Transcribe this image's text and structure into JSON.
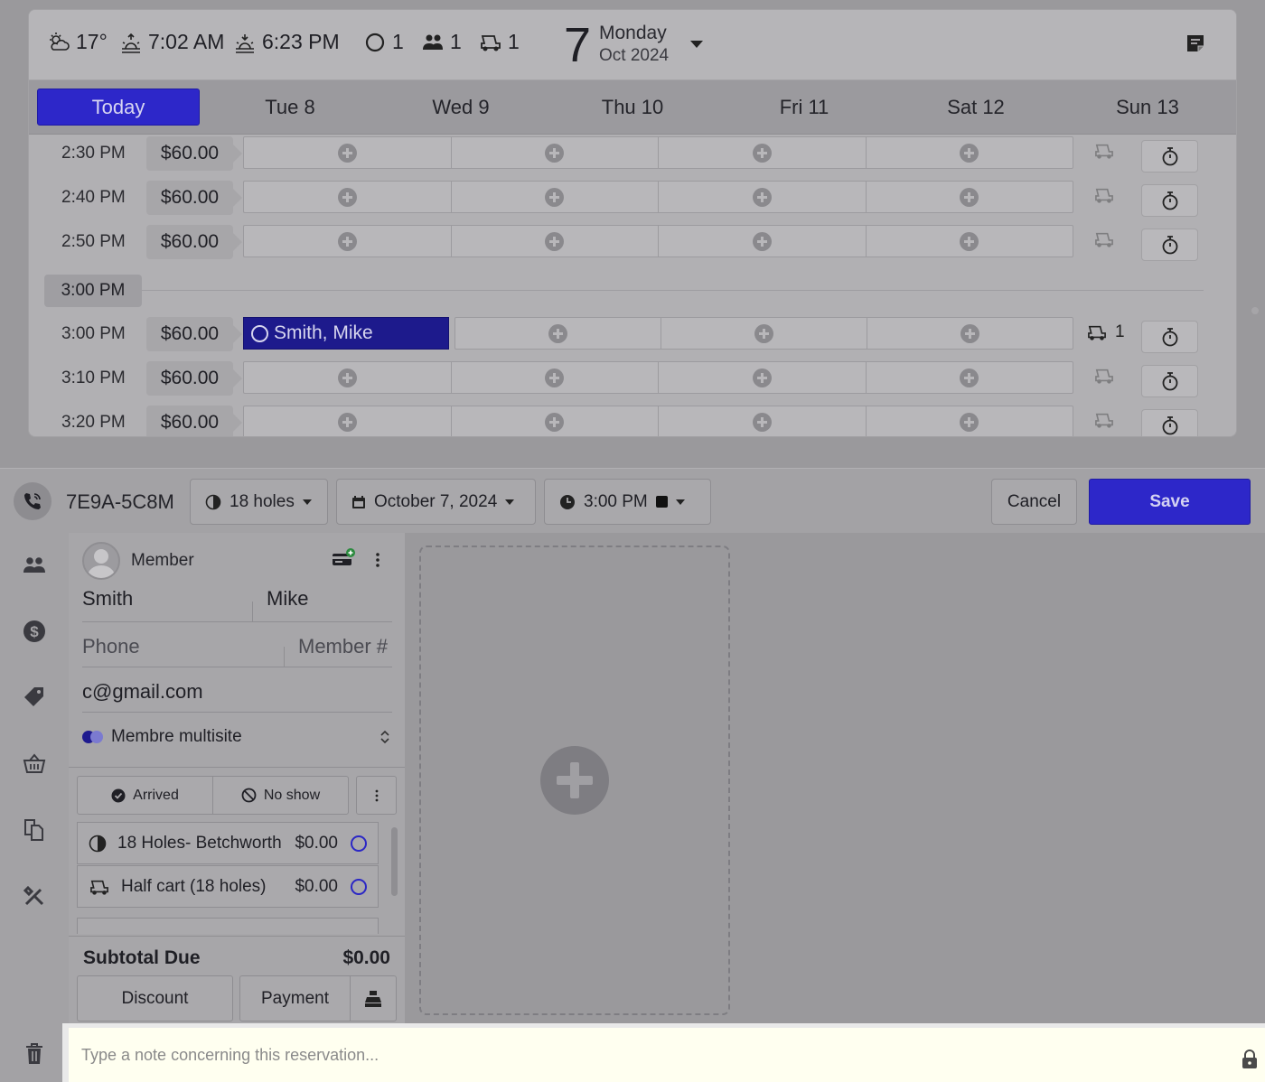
{
  "weather": {
    "temperature": "17°",
    "sunrise": "7:02 AM",
    "sunset": "6:23 PM"
  },
  "counters": {
    "reservations": "1",
    "players": "1",
    "carts": "1"
  },
  "current_date": {
    "day_number": "7",
    "day_name": "Monday",
    "month_year": "Oct 2024"
  },
  "day_tabs": [
    "Today",
    "Tue 8",
    "Wed 9",
    "Thu 10",
    "Fri 11",
    "Sat 12",
    "Sun 13"
  ],
  "tee_times": [
    {
      "time": "2:30 PM",
      "price": "$60.00"
    },
    {
      "time": "2:40 PM",
      "price": "$60.00"
    },
    {
      "time": "2:50 PM",
      "price": "$60.00"
    },
    {
      "time": "3:00 PM",
      "price": "$60.00",
      "booked_player": "Smith, Mike",
      "cart_count": "1"
    },
    {
      "time": "3:10 PM",
      "price": "$60.00"
    },
    {
      "time": "3:20 PM",
      "price": "$60.00"
    }
  ],
  "hour_separator": "3:00 PM",
  "toolbar": {
    "reservation_code": "7E9A-5C8M",
    "holes": "18 holes",
    "date": "October 7, 2024",
    "time": "3:00 PM",
    "cancel_label": "Cancel",
    "save_label": "Save"
  },
  "player": {
    "type": "Member",
    "last_name": "Smith",
    "first_name": "Mike",
    "phone_placeholder": "Phone",
    "member_number_placeholder": "Member #",
    "email": "c@gmail.com",
    "membership": "Membre multisite",
    "arrived_label": "Arrived",
    "no_show_label": "No show",
    "items": [
      {
        "name": "18 Holes- Betchworth",
        "price": "$0.00",
        "icon": "golf-ball-icon"
      },
      {
        "name": "Half cart (18 holes)",
        "price": "$0.00",
        "icon": "golf-cart-icon"
      }
    ],
    "subtotal_label": "Subtotal Due",
    "subtotal_value": "$0.00",
    "discount_label": "Discount",
    "payment_label": "Payment"
  },
  "note": {
    "placeholder": "Type a note concerning this reservation..."
  },
  "colors": {
    "accent": "#2d27c9",
    "booked": "#1d1a8c",
    "note_background": "#fffff0"
  }
}
